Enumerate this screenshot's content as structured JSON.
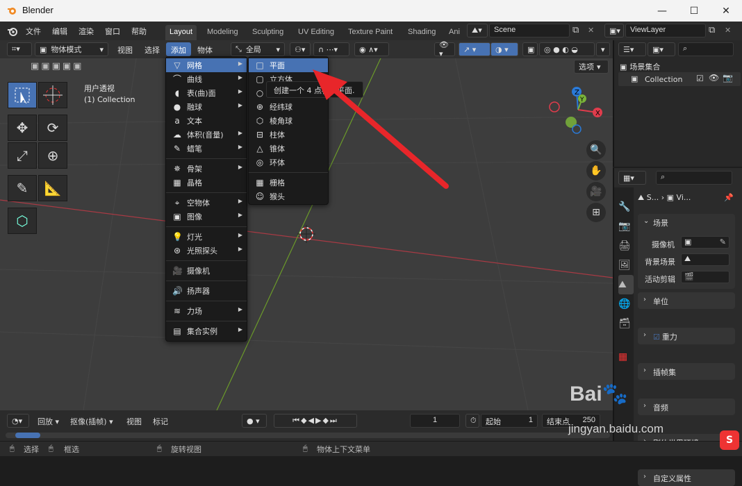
{
  "window": {
    "title": "Blender",
    "min": "—",
    "max": "☐",
    "close": "✕"
  },
  "topmenu": [
    "文件",
    "编辑",
    "渲染",
    "窗口",
    "帮助"
  ],
  "workspaces": [
    "Layout",
    "Modeling",
    "Sculpting",
    "UV Editing",
    "Texture Paint",
    "Shading",
    "Ani"
  ],
  "scene": "Scene",
  "viewlayer": "ViewLayer",
  "viewport_header": {
    "mode": "物体模式",
    "view": "视图",
    "select": "选择",
    "add": "添加",
    "object": "物体",
    "transform": "全局",
    "options": "选项"
  },
  "overlay_text": {
    "view_name": "用户透视",
    "collection": "(1) Collection"
  },
  "add_menu": {
    "items": [
      {
        "label": "网格",
        "icon": "mesh-icon",
        "sub": true
      },
      {
        "label": "曲线",
        "icon": "curve-icon",
        "sub": true
      },
      {
        "label": "表(曲)面",
        "icon": "surface-icon",
        "sub": true
      },
      {
        "label": "融球",
        "icon": "metaball-icon",
        "sub": true
      },
      {
        "label": "文本",
        "icon": "text-icon",
        "sub": false
      },
      {
        "label": "体积(音量)",
        "icon": "volume-icon",
        "sub": true
      },
      {
        "label": "蜡笔",
        "icon": "grease-pencil-icon",
        "sub": true
      }
    ],
    "items2": [
      {
        "label": "骨架",
        "icon": "armature-icon",
        "sub": true
      },
      {
        "label": "晶格",
        "icon": "lattice-icon",
        "sub": false
      }
    ],
    "items3": [
      {
        "label": "空物体",
        "icon": "empty-icon",
        "sub": true
      },
      {
        "label": "图像",
        "icon": "image-icon",
        "sub": true
      }
    ],
    "items4": [
      {
        "label": "灯光",
        "icon": "light-icon",
        "sub": true
      },
      {
        "label": "光照探头",
        "icon": "light-probe-icon",
        "sub": true
      }
    ],
    "items5": [
      {
        "label": "摄像机",
        "icon": "camera-icon",
        "sub": false
      }
    ],
    "items6": [
      {
        "label": "扬声器",
        "icon": "speaker-icon",
        "sub": false
      }
    ],
    "items7": [
      {
        "label": "力场",
        "icon": "force-field-icon",
        "sub": true
      }
    ],
    "items8": [
      {
        "label": "集合实例",
        "icon": "collection-instance-icon",
        "sub": true
      }
    ]
  },
  "mesh_menu": {
    "items": [
      "平面",
      "立方体",
      "",
      "经纬球",
      "棱角球",
      "柱体",
      "锥体",
      "环体"
    ],
    "items2": [
      "栅格",
      "猴头"
    ],
    "tooltip": "创建一个 4 点标准平面."
  },
  "outliner": {
    "root": "场景集合",
    "collection": "Collection"
  },
  "properties": {
    "breadcrumb_scene": "S...",
    "breadcrumb_layer": "Vi...",
    "scene_panel": "场景",
    "camera_label": "摄像机",
    "bg_scene_label": "背景场景",
    "active_clip_label": "活动剪辑",
    "panels": [
      "单位",
      "重力",
      "插帧集",
      "音频",
      "刚体世界环境",
      "自定义属性"
    ]
  },
  "timeline": {
    "playback": "回放",
    "keying": "抠像(插帧)",
    "view": "视图",
    "marker": "标记",
    "current_frame": "1",
    "start_label": "起始",
    "start": "1",
    "end_label": "结束点",
    "end": "250"
  },
  "statusbar": {
    "select": "选择",
    "box": "框选",
    "rotate": "旋转视图",
    "context": "物体上下文菜单"
  },
  "watermark": {
    "line1": "Bai",
    "line2": "jingyan.baidu.com"
  },
  "colors": {
    "accent": "#4772b3",
    "x_axis": "#e03c4c",
    "y_axis": "#7ab33a",
    "arrow": "#e8262a"
  }
}
